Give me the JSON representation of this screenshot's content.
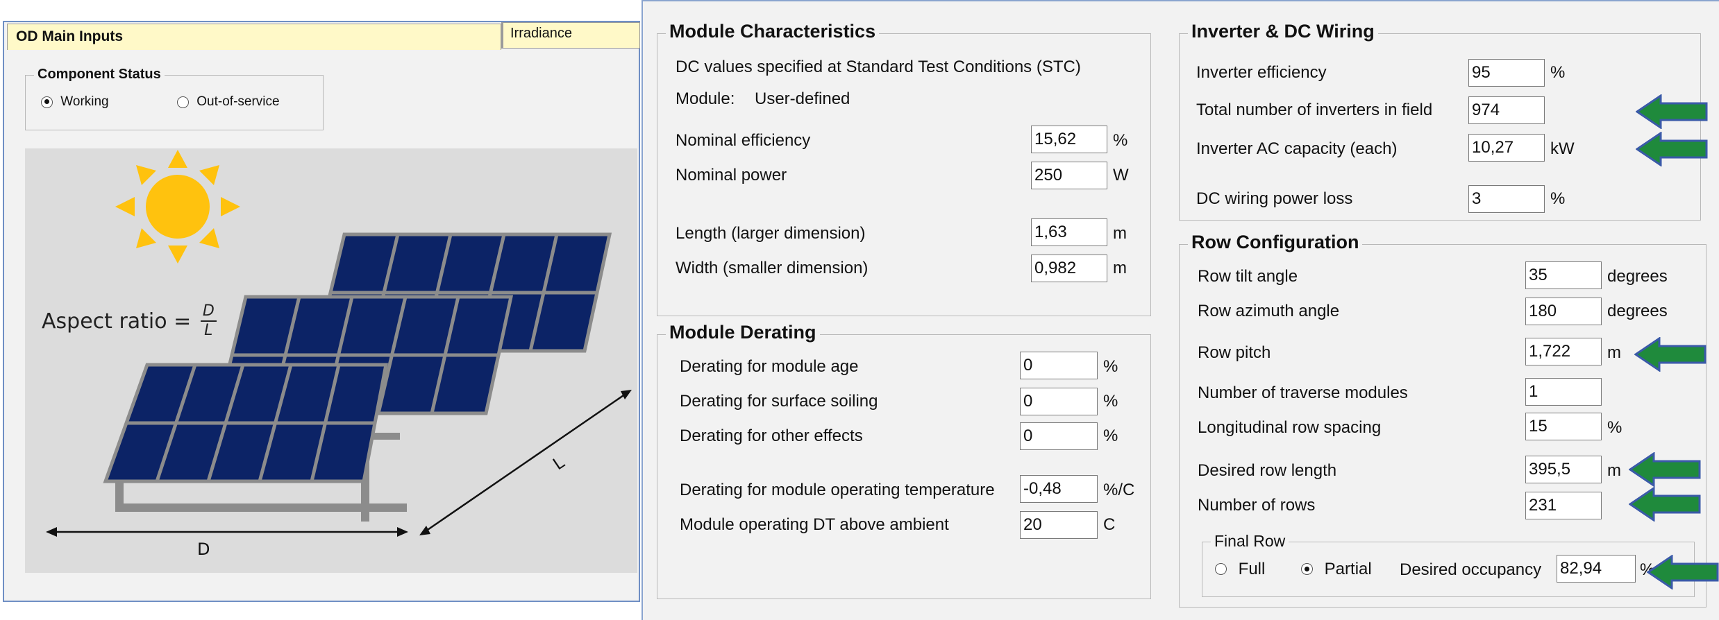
{
  "left": {
    "tabs": [
      {
        "label": "OD Main Inputs",
        "active": true
      },
      {
        "label": "Irradiance",
        "active": false
      }
    ],
    "component_status": {
      "title": "Component Status",
      "options": [
        {
          "label": "Working",
          "selected": true
        },
        {
          "label": "Out-of-service",
          "selected": false
        }
      ]
    },
    "illustration": {
      "aspect_ratio_label": "Aspect ratio = ",
      "fraction_numerator": "D",
      "fraction_denominator": "L",
      "d_label": "D",
      "l_label": "L"
    }
  },
  "module_characteristics": {
    "title": "Module Characteristics",
    "stc_note": "DC values specified at Standard Test Conditions (STC)",
    "module_label": "Module:",
    "module_value": "User-defined",
    "fields": [
      {
        "label": "Nominal efficiency",
        "value": "15,62",
        "unit": "%"
      },
      {
        "label": "Nominal power",
        "value": "250",
        "unit": "W"
      },
      {
        "label": "Length (larger dimension)",
        "value": "1,63",
        "unit": "m"
      },
      {
        "label": "Width (smaller dimension)",
        "value": "0,982",
        "unit": "m"
      }
    ]
  },
  "module_derating": {
    "title": "Module Derating",
    "fields": [
      {
        "label": "Derating for module age",
        "value": "0",
        "unit": "%"
      },
      {
        "label": "Derating for surface soiling",
        "value": "0",
        "unit": "%"
      },
      {
        "label": "Derating for other effects",
        "value": "0",
        "unit": "%"
      },
      {
        "label": "Derating for module operating temperature",
        "value": "-0,48",
        "unit": "%/C"
      },
      {
        "label": "Module operating DT above ambient",
        "value": "20",
        "unit": "C"
      }
    ]
  },
  "inverter": {
    "title": "Inverter & DC Wiring",
    "fields": [
      {
        "label": "Inverter efficiency",
        "value": "95",
        "unit": "%"
      },
      {
        "label": "Total number of inverters in field",
        "value": "974",
        "unit": ""
      },
      {
        "label": "Inverter AC capacity (each)",
        "value": "10,27",
        "unit": "kW"
      },
      {
        "label": "DC wiring power loss",
        "value": "3",
        "unit": "%"
      }
    ]
  },
  "row_config": {
    "title": "Row Configuration",
    "fields": [
      {
        "label": "Row tilt angle",
        "value": "35",
        "unit": "degrees"
      },
      {
        "label": "Row azimuth angle",
        "value": "180",
        "unit": "degrees"
      },
      {
        "label": "Row pitch",
        "value": "1,722",
        "unit": "m"
      },
      {
        "label": "Number of traverse modules",
        "value": "1",
        "unit": ""
      },
      {
        "label": "Longitudinal row spacing",
        "value": "15",
        "unit": "%"
      },
      {
        "label": "Desired row length",
        "value": "395,5",
        "unit": "m"
      },
      {
        "label": "Number of rows",
        "value": "231",
        "unit": ""
      }
    ],
    "final_row": {
      "title": "Final Row",
      "options": [
        {
          "label": "Full",
          "selected": false
        },
        {
          "label": "Partial",
          "selected": true
        }
      ],
      "occupancy_label": "Desired occupancy",
      "occupancy_value": "82,94",
      "occupancy_unit": "%"
    }
  },
  "colors": {
    "arrow_fill": "#1f8a3c",
    "arrow_outline": "#3a5aa8",
    "panel_blue": "#0c2366",
    "sun": "#ffc20e",
    "tab_bg": "#fff9c8"
  }
}
